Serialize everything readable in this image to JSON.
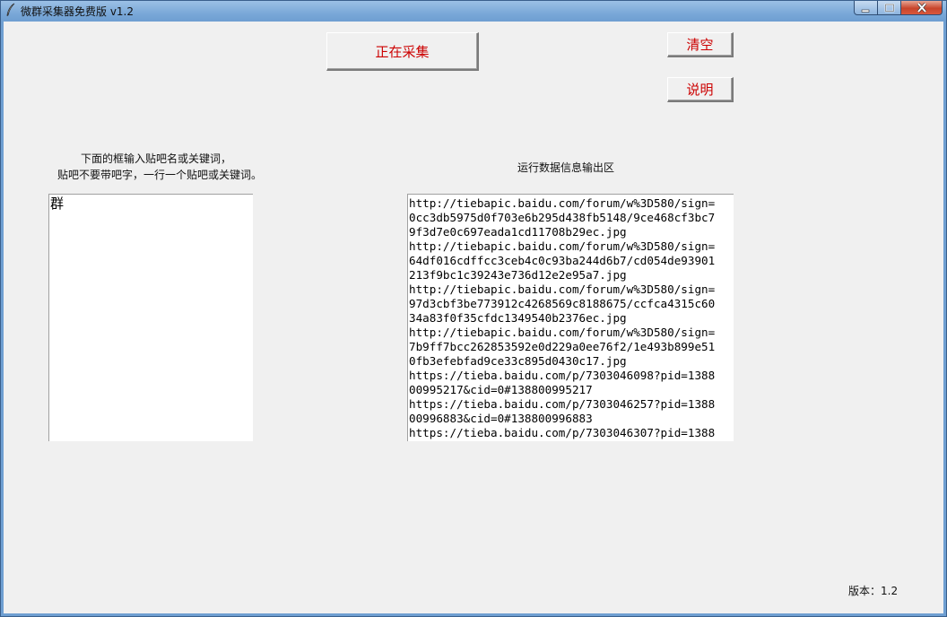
{
  "window": {
    "title": "微群采集器免费版 v1.2"
  },
  "toolbar": {
    "collect_label": "正在采集",
    "clear_label": "清空",
    "help_label": "说明"
  },
  "input": {
    "instruction_line1": "下面的框输入贴吧名或关键词，",
    "instruction_line2": "贴吧不要带吧字，一行一个贴吧或关键词。",
    "value": "群"
  },
  "output": {
    "heading": "运行数据信息输出区",
    "lines": [
      "http://tiebapic.baidu.com/forum/w%3D580/sign=",
      "0cc3db5975d0f703e6b295d438fb5148/9ce468cf3bc7",
      "9f3d7e0c697eada1cd11708b29ec.jpg",
      "http://tiebapic.baidu.com/forum/w%3D580/sign=",
      "64df016cdffcc3ceb4c0c93ba244d6b7/cd054de93901",
      "213f9bc1c39243e736d12e2e95a7.jpg",
      "http://tiebapic.baidu.com/forum/w%3D580/sign=",
      "97d3cbf3be773912c4268569c8188675/ccfca4315c60",
      "34a83f0f35cfdc1349540b2376ec.jpg",
      "http://tiebapic.baidu.com/forum/w%3D580/sign=",
      "7b9ff7bcc262853592e0d229a0ee76f2/1e493b899e51",
      "0fb3efebfad9ce33c895d0430c17.jpg",
      "https://tieba.baidu.com/p/7303046098?pid=1388",
      "00995217&cid=0#138800995217",
      "https://tieba.baidu.com/p/7303046257?pid=1388",
      "00996883&cid=0#138800996883",
      "https://tieba.baidu.com/p/7303046307?pid=1388"
    ]
  },
  "footer": {
    "version_text": "版本：1.2"
  },
  "icons": {
    "app": "feather-icon",
    "minimize": "minimize-icon",
    "maximize": "maximize-icon",
    "close": "close-icon"
  },
  "colors": {
    "button_text": "#cc0000",
    "client_bg": "#f0f0f0",
    "close_button": "#c8452c"
  }
}
